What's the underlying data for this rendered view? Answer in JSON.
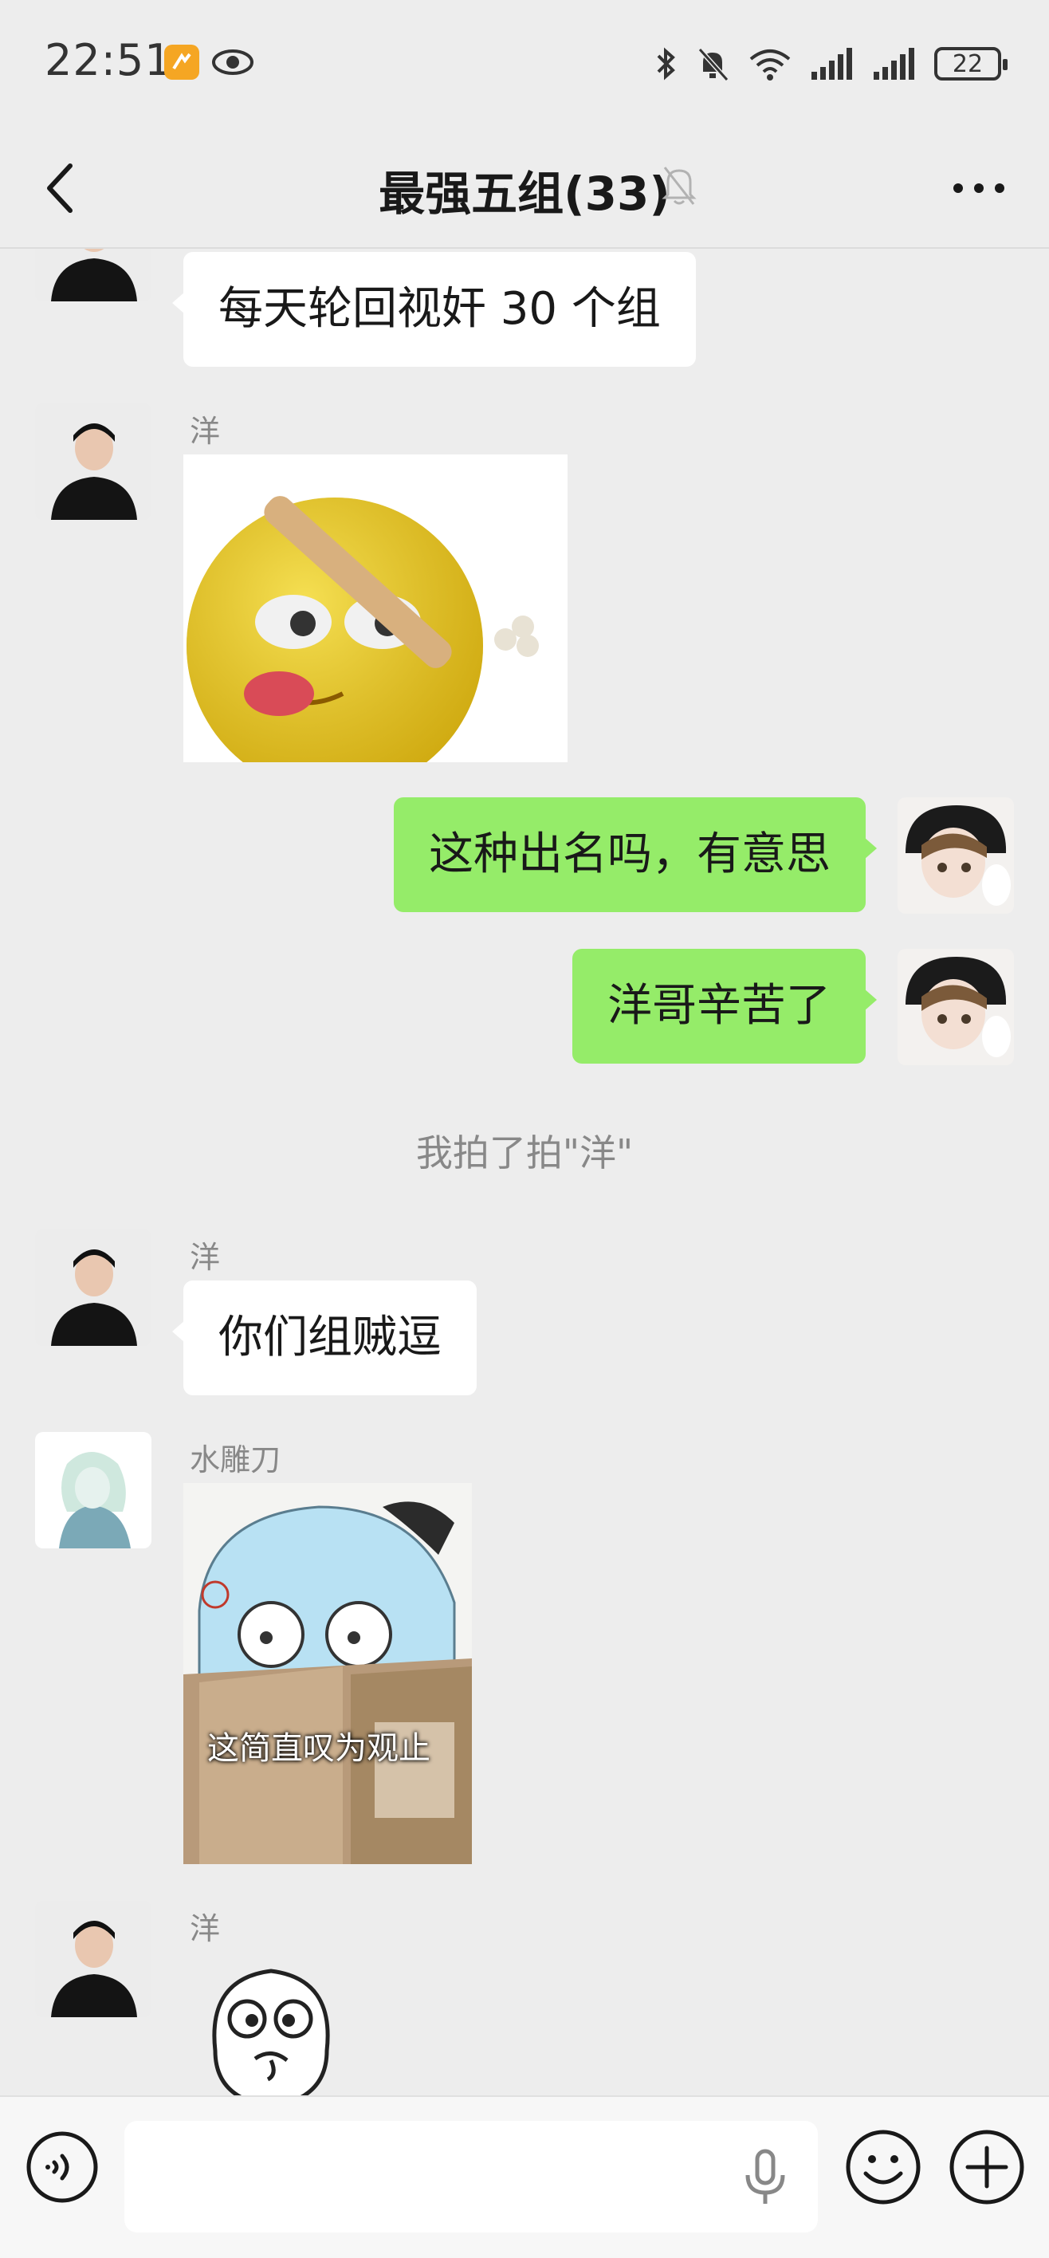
{
  "status_bar": {
    "time": "22:51",
    "battery": "22",
    "icons": [
      "app-icon",
      "eye-icon",
      "bluetooth-icon",
      "mute-icon",
      "wifi-icon",
      "signal-icon",
      "signal-icon",
      "battery-icon"
    ]
  },
  "header": {
    "title": "最强五组(33)",
    "icons": [
      "back-icon",
      "mute-icon",
      "more-icon"
    ]
  },
  "messages": [
    {
      "type": "text",
      "direction": "in",
      "sender": "",
      "text": "每天轮回视奸 30 个组"
    },
    {
      "type": "sticker",
      "direction": "in",
      "sender": "洋",
      "sticker": "yellow-face-bat-sticker"
    },
    {
      "type": "text",
      "direction": "out",
      "text": "这种出名吗，有意思"
    },
    {
      "type": "text",
      "direction": "out",
      "text": "洋哥辛苦了"
    },
    {
      "type": "system",
      "text": "我拍了拍\"洋\""
    },
    {
      "type": "text",
      "direction": "in",
      "sender": "洋",
      "text": "你们组贼逗"
    },
    {
      "type": "sticker",
      "direction": "in",
      "sender": "水雕刀",
      "sticker": "anime-reading-sticker",
      "caption": "这简直叹为观止"
    },
    {
      "type": "sticker",
      "direction": "in",
      "sender": "洋",
      "sticker": "cartoon-face-sticker"
    }
  ],
  "input_bar": {
    "placeholder": "",
    "icons": [
      "voice-icon",
      "mic-icon",
      "emoji-icon",
      "plus-icon"
    ]
  },
  "colors": {
    "background": "#ededed",
    "outgoing_bubble": "#95ec69",
    "incoming_bubble": "#ffffff",
    "secondary_text": "#888888"
  }
}
